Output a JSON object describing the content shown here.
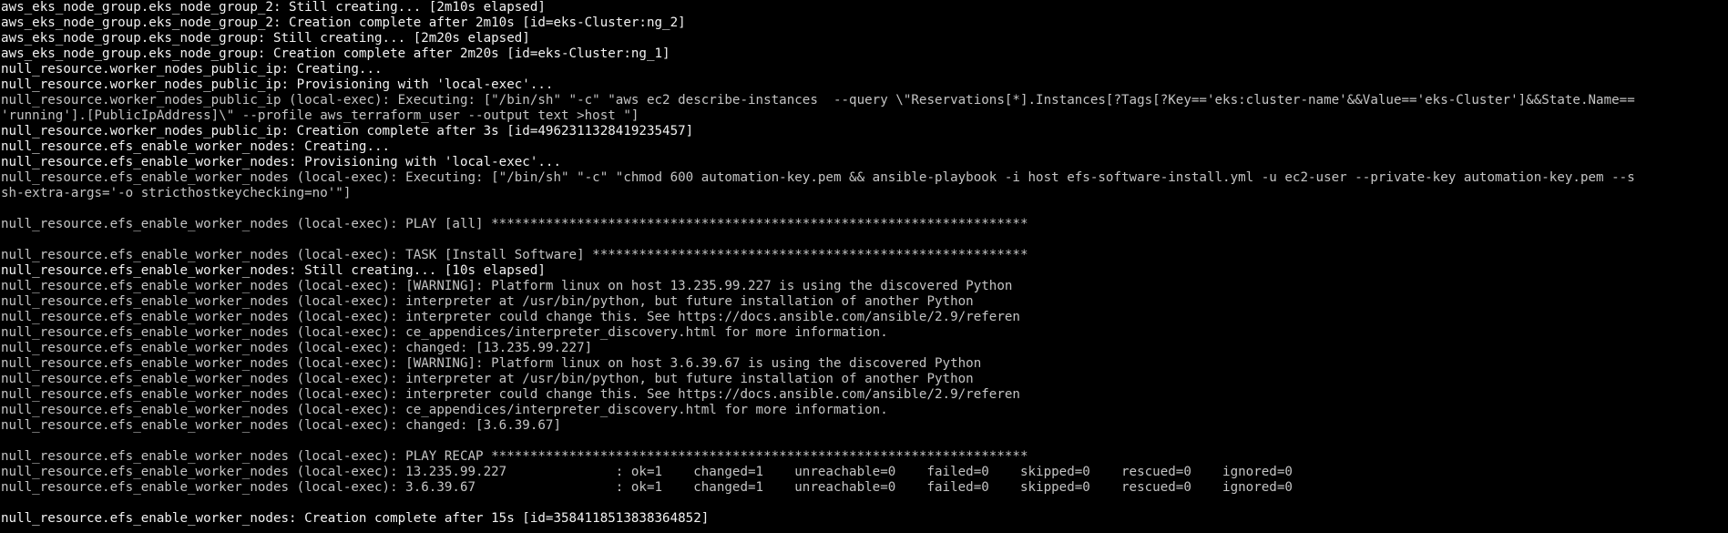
{
  "terminal": {
    "lines": [
      {
        "text": "aws_eks_node_group.eks_node_group_2: Still creating... [2m10s elapsed]",
        "style": "bright"
      },
      {
        "text": "aws_eks_node_group.eks_node_group_2: Creation complete after 2m10s [id=eks-Cluster:ng_2]",
        "style": "bright"
      },
      {
        "text": "aws_eks_node_group.eks_node_group: Still creating... [2m20s elapsed]",
        "style": "bright"
      },
      {
        "text": "aws_eks_node_group.eks_node_group: Creation complete after 2m20s [id=eks-Cluster:ng_1]",
        "style": "bright"
      },
      {
        "text": "null_resource.worker_nodes_public_ip: Creating...",
        "style": "bright"
      },
      {
        "text": "null_resource.worker_nodes_public_ip: Provisioning with 'local-exec'...",
        "style": "bright"
      },
      {
        "text": "null_resource.worker_nodes_public_ip (local-exec): Executing: [\"/bin/sh\" \"-c\" \"aws ec2 describe-instances  --query \\\"Reservations[*].Instances[?Tags[?Key=='eks:cluster-name'&&Value=='eks-Cluster']&&State.Name==",
        "style": "dim"
      },
      {
        "text": "'running'].[PublicIpAddress]\\\" --profile aws_terraform_user --output text >host \"]",
        "style": "dim"
      },
      {
        "text": "null_resource.worker_nodes_public_ip: Creation complete after 3s [id=4962311328419235457]",
        "style": "bright"
      },
      {
        "text": "null_resource.efs_enable_worker_nodes: Creating...",
        "style": "bright"
      },
      {
        "text": "null_resource.efs_enable_worker_nodes: Provisioning with 'local-exec'...",
        "style": "bright"
      },
      {
        "text": "null_resource.efs_enable_worker_nodes (local-exec): Executing: [\"/bin/sh\" \"-c\" \"chmod 600 automation-key.pem && ansible-playbook -i host efs-software-install.yml -u ec2-user --private-key automation-key.pem --s",
        "style": "dim"
      },
      {
        "text": "sh-extra-args='-o stricthostkeychecking=no'\"]",
        "style": "dim"
      },
      {
        "text": "",
        "style": "blank"
      },
      {
        "text": "null_resource.efs_enable_worker_nodes (local-exec): PLAY [all] *********************************************************************",
        "style": "dim"
      },
      {
        "text": "",
        "style": "blank"
      },
      {
        "text": "null_resource.efs_enable_worker_nodes (local-exec): TASK [Install Software] ********************************************************",
        "style": "dim"
      },
      {
        "text": "null_resource.efs_enable_worker_nodes: Still creating... [10s elapsed]",
        "style": "bright"
      },
      {
        "text": "null_resource.efs_enable_worker_nodes (local-exec): [WARNING]: Platform linux on host 13.235.99.227 is using the discovered Python",
        "style": "dim"
      },
      {
        "text": "null_resource.efs_enable_worker_nodes (local-exec): interpreter at /usr/bin/python, but future installation of another Python",
        "style": "dim"
      },
      {
        "text": "null_resource.efs_enable_worker_nodes (local-exec): interpreter could change this. See https://docs.ansible.com/ansible/2.9/referen",
        "style": "dim"
      },
      {
        "text": "null_resource.efs_enable_worker_nodes (local-exec): ce_appendices/interpreter_discovery.html for more information.",
        "style": "dim"
      },
      {
        "text": "null_resource.efs_enable_worker_nodes (local-exec): changed: [13.235.99.227]",
        "style": "dim"
      },
      {
        "text": "null_resource.efs_enable_worker_nodes (local-exec): [WARNING]: Platform linux on host 3.6.39.67 is using the discovered Python",
        "style": "dim"
      },
      {
        "text": "null_resource.efs_enable_worker_nodes (local-exec): interpreter at /usr/bin/python, but future installation of another Python",
        "style": "dim"
      },
      {
        "text": "null_resource.efs_enable_worker_nodes (local-exec): interpreter could change this. See https://docs.ansible.com/ansible/2.9/referen",
        "style": "dim"
      },
      {
        "text": "null_resource.efs_enable_worker_nodes (local-exec): ce_appendices/interpreter_discovery.html for more information.",
        "style": "dim"
      },
      {
        "text": "null_resource.efs_enable_worker_nodes (local-exec): changed: [3.6.39.67]",
        "style": "dim"
      },
      {
        "text": "",
        "style": "blank"
      },
      {
        "text": "null_resource.efs_enable_worker_nodes (local-exec): PLAY RECAP *********************************************************************",
        "style": "dim"
      },
      {
        "text": "null_resource.efs_enable_worker_nodes (local-exec): 13.235.99.227              : ok=1    changed=1    unreachable=0    failed=0    skipped=0    rescued=0    ignored=0",
        "style": "dim"
      },
      {
        "text": "null_resource.efs_enable_worker_nodes (local-exec): 3.6.39.67                  : ok=1    changed=1    unreachable=0    failed=0    skipped=0    rescued=0    ignored=0",
        "style": "dim"
      },
      {
        "text": "",
        "style": "blank"
      },
      {
        "text": "null_resource.efs_enable_worker_nodes: Creation complete after 15s [id=3584118513838364852]",
        "style": "bright"
      }
    ]
  },
  "colors": {
    "background": "#000000",
    "bright_text": "#f2f2f2",
    "dim_text": "#c4c4c4"
  }
}
